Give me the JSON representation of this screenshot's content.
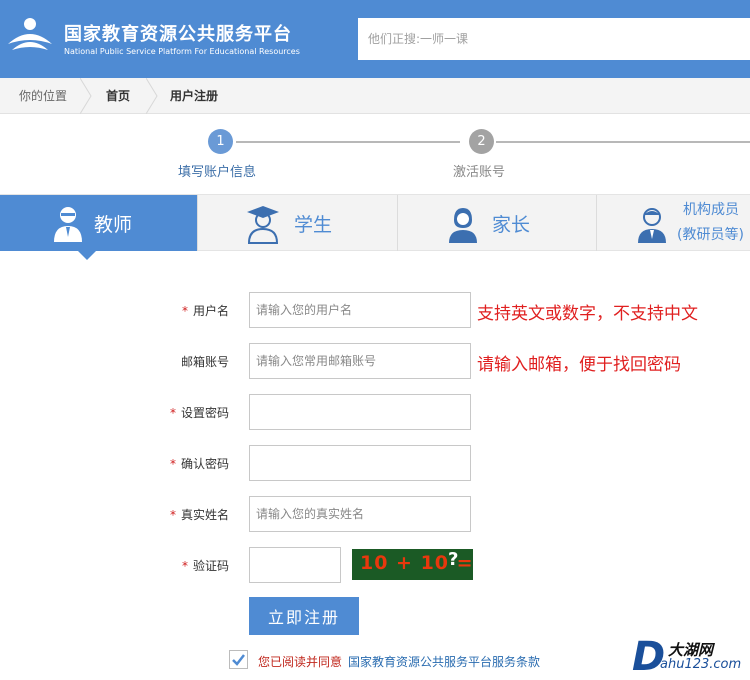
{
  "header": {
    "title_cn": "国家教育资源公共服务平台",
    "title_en": "National Public Service Platform For Educational Resources",
    "search_placeholder": "他们正搜:一师一课",
    "brand_color": "#4f8bd3"
  },
  "breadcrumb": {
    "position_label": "你的位置",
    "home": "首页",
    "current": "用户注册"
  },
  "steps": [
    {
      "number": "1",
      "label": "填写账户信息",
      "active": true
    },
    {
      "number": "2",
      "label": "激活账号",
      "active": false
    }
  ],
  "tabs": [
    {
      "label": "教师",
      "icon": "teacher-icon",
      "active": true
    },
    {
      "label": "学生",
      "icon": "student-icon",
      "active": false
    },
    {
      "label": "家长",
      "icon": "parent-icon",
      "active": false
    },
    {
      "label_line1": "机构成员",
      "label_line2": "(教研员等)",
      "icon": "member-icon",
      "active": false
    }
  ],
  "form": {
    "username": {
      "label": "用户名",
      "required": "*",
      "placeholder": "请输入您的用户名",
      "hint": "支持英文或数字，不支持中文"
    },
    "email": {
      "label": "邮箱账号",
      "placeholder": "请输入您常用邮箱账号",
      "hint": "请输入邮箱，便于找回密码"
    },
    "password": {
      "label": "设置密码",
      "required": "*"
    },
    "confirm_password": {
      "label": "确认密码",
      "required": "*"
    },
    "real_name": {
      "label": "真实姓名",
      "required": "*",
      "placeholder": "请输入您的真实姓名"
    },
    "captcha": {
      "label": "验证码",
      "required": "*",
      "image_text": "10 + 10 =",
      "image_question": "?"
    }
  },
  "submit_label": "立即注册",
  "agreement": {
    "text": "您已阅读并同意",
    "link": "国家教育资源公共服务平台服务条款",
    "checked": true
  },
  "watermark": {
    "cn": "大湖网",
    "en": "ahu123.com",
    "letter": "D"
  }
}
